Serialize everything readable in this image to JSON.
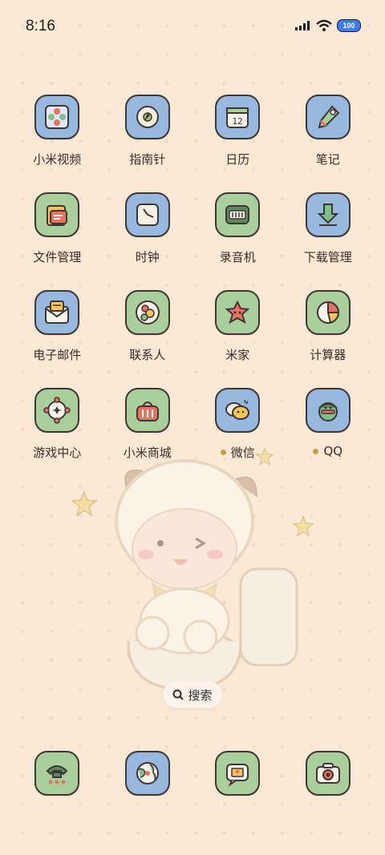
{
  "status_bar": {
    "time": "8:16",
    "battery": "100"
  },
  "apps": [
    [
      {
        "label": "小米视频",
        "icon": "video-icon",
        "bg": "blue"
      },
      {
        "label": "指南针",
        "icon": "compass-icon",
        "bg": "blue"
      },
      {
        "label": "日历",
        "icon": "calendar-icon",
        "bg": "blue",
        "icon_text": "12"
      },
      {
        "label": "笔记",
        "icon": "notes-icon",
        "bg": "blue"
      }
    ],
    [
      {
        "label": "文件管理",
        "icon": "folder-icon",
        "bg": "green"
      },
      {
        "label": "时钟",
        "icon": "clock-icon",
        "bg": "blue"
      },
      {
        "label": "录音机",
        "icon": "recorder-icon",
        "bg": "green"
      },
      {
        "label": "下载管理",
        "icon": "download-icon",
        "bg": "blue"
      }
    ],
    [
      {
        "label": "电子邮件",
        "icon": "mail-icon",
        "bg": "blue"
      },
      {
        "label": "联系人",
        "icon": "contacts-icon",
        "bg": "green"
      },
      {
        "label": "米家",
        "icon": "mijia-icon",
        "bg": "green"
      },
      {
        "label": "计算器",
        "icon": "calculator-icon",
        "bg": "green"
      }
    ],
    [
      {
        "label": "游戏中心",
        "icon": "game-center-icon",
        "bg": "green"
      },
      {
        "label": "小米商城",
        "icon": "shop-basket-icon",
        "bg": "green"
      },
      {
        "label": "微信",
        "icon": "wechat-icon",
        "bg": "blue",
        "dot": true
      },
      {
        "label": "QQ",
        "icon": "qq-icon",
        "bg": "blue",
        "dot": true
      }
    ]
  ],
  "search": {
    "label": "搜索"
  },
  "dock": [
    {
      "icon": "phone-icon",
      "bg": "green"
    },
    {
      "icon": "browser-globe-icon",
      "bg": "blue"
    },
    {
      "icon": "messages-icon",
      "bg": "green"
    },
    {
      "icon": "camera-icon",
      "bg": "green"
    }
  ],
  "colors": {
    "wallpaper": "#fbe9d6",
    "icon_blue": "#97b9df",
    "icon_green": "#a9cf9d",
    "notification_dot": "#c99a48"
  }
}
